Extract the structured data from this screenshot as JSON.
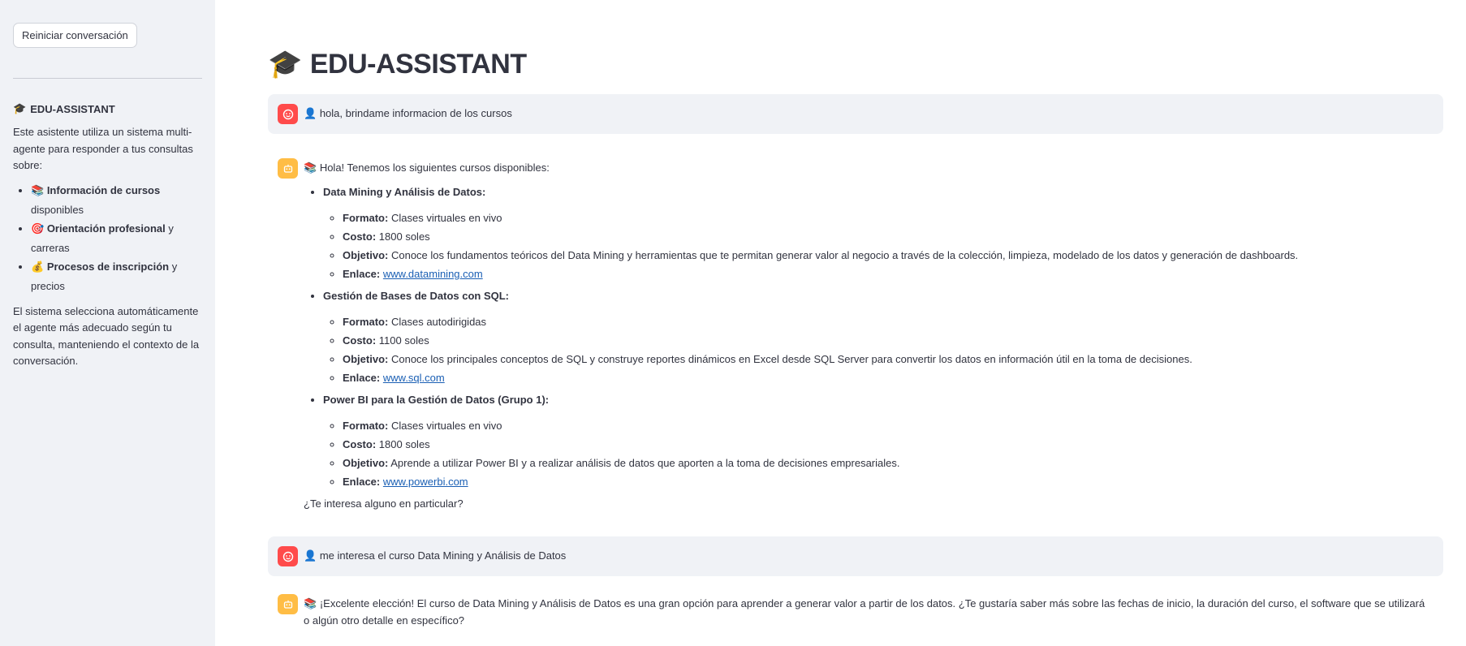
{
  "sidebar": {
    "reset_button": "Reiniciar conversación",
    "title_icon": "🎓",
    "title": "EDU-ASSISTANT",
    "intro": "Este asistente utiliza un sistema multi-agente para responder a tus consultas sobre:",
    "features": [
      {
        "icon": "📚",
        "bold": "Información de cursos",
        "rest": " disponibles"
      },
      {
        "icon": "🎯",
        "bold": "Orientación profesional",
        "rest": " y carreras"
      },
      {
        "icon": "💰",
        "bold": "Procesos de inscripción",
        "rest": " y precios"
      }
    ],
    "footer": "El sistema selecciona automáticamente el agente más adecuado según tu consulta, manteniendo el contexto de la conversación."
  },
  "header": {
    "icon": "🎓",
    "title": "EDU-ASSISTANT"
  },
  "chat": {
    "msg1": {
      "role": "user",
      "icon": "👤",
      "text": "hola, brindame informacion de los cursos"
    },
    "msg2": {
      "role": "assistant",
      "icon": "📚",
      "intro": "Hola! Tenemos los siguientes cursos disponibles:",
      "labels": {
        "format": "Formato:",
        "cost": "Costo:",
        "objective": "Objetivo:",
        "link": "Enlace:"
      },
      "courses": [
        {
          "name": "Data Mining y Análisis de Datos:",
          "format": "Clases virtuales en vivo",
          "cost": "1800 soles",
          "objective": "Conoce los fundamentos teóricos del Data Mining y herramientas que te permitan generar valor al negocio a través de la colección, limpieza, modelado de los datos y generación de dashboards.",
          "link": "www.datamining.com"
        },
        {
          "name": "Gestión de Bases de Datos con SQL:",
          "format": "Clases autodirigidas",
          "cost": "1100 soles",
          "objective": "Conoce los principales conceptos de SQL y construye reportes dinámicos en Excel desde SQL Server para convertir los datos en información útil en la toma de decisiones.",
          "link": "www.sql.com"
        },
        {
          "name": "Power BI para la Gestión de Datos (Grupo 1):",
          "format": "Clases virtuales en vivo",
          "cost": "1800 soles",
          "objective": "Aprende a utilizar Power BI y a realizar análisis de datos que aporten a la toma de decisiones empresariales.",
          "link": "www.powerbi.com"
        }
      ],
      "closing": "¿Te interesa alguno en particular?"
    },
    "msg3": {
      "role": "user",
      "icon": "👤",
      "text": "me interesa el curso Data Mining y Análisis de Datos"
    },
    "msg4": {
      "role": "assistant",
      "icon": "📚",
      "text": "¡Excelente elección! El curso de Data Mining y Análisis de Datos es una gran opción para aprender a generar valor a partir de los datos. ¿Te gustaría saber más sobre las fechas de inicio, la duración del curso, el software que se utilizará o algún otro detalle en específico?"
    }
  },
  "colors": {
    "sidebar_bg": "#f0f2f6",
    "user_avatar": "#ff4b4b",
    "bot_avatar": "#ffbd45",
    "link": "#1a5fb4"
  }
}
